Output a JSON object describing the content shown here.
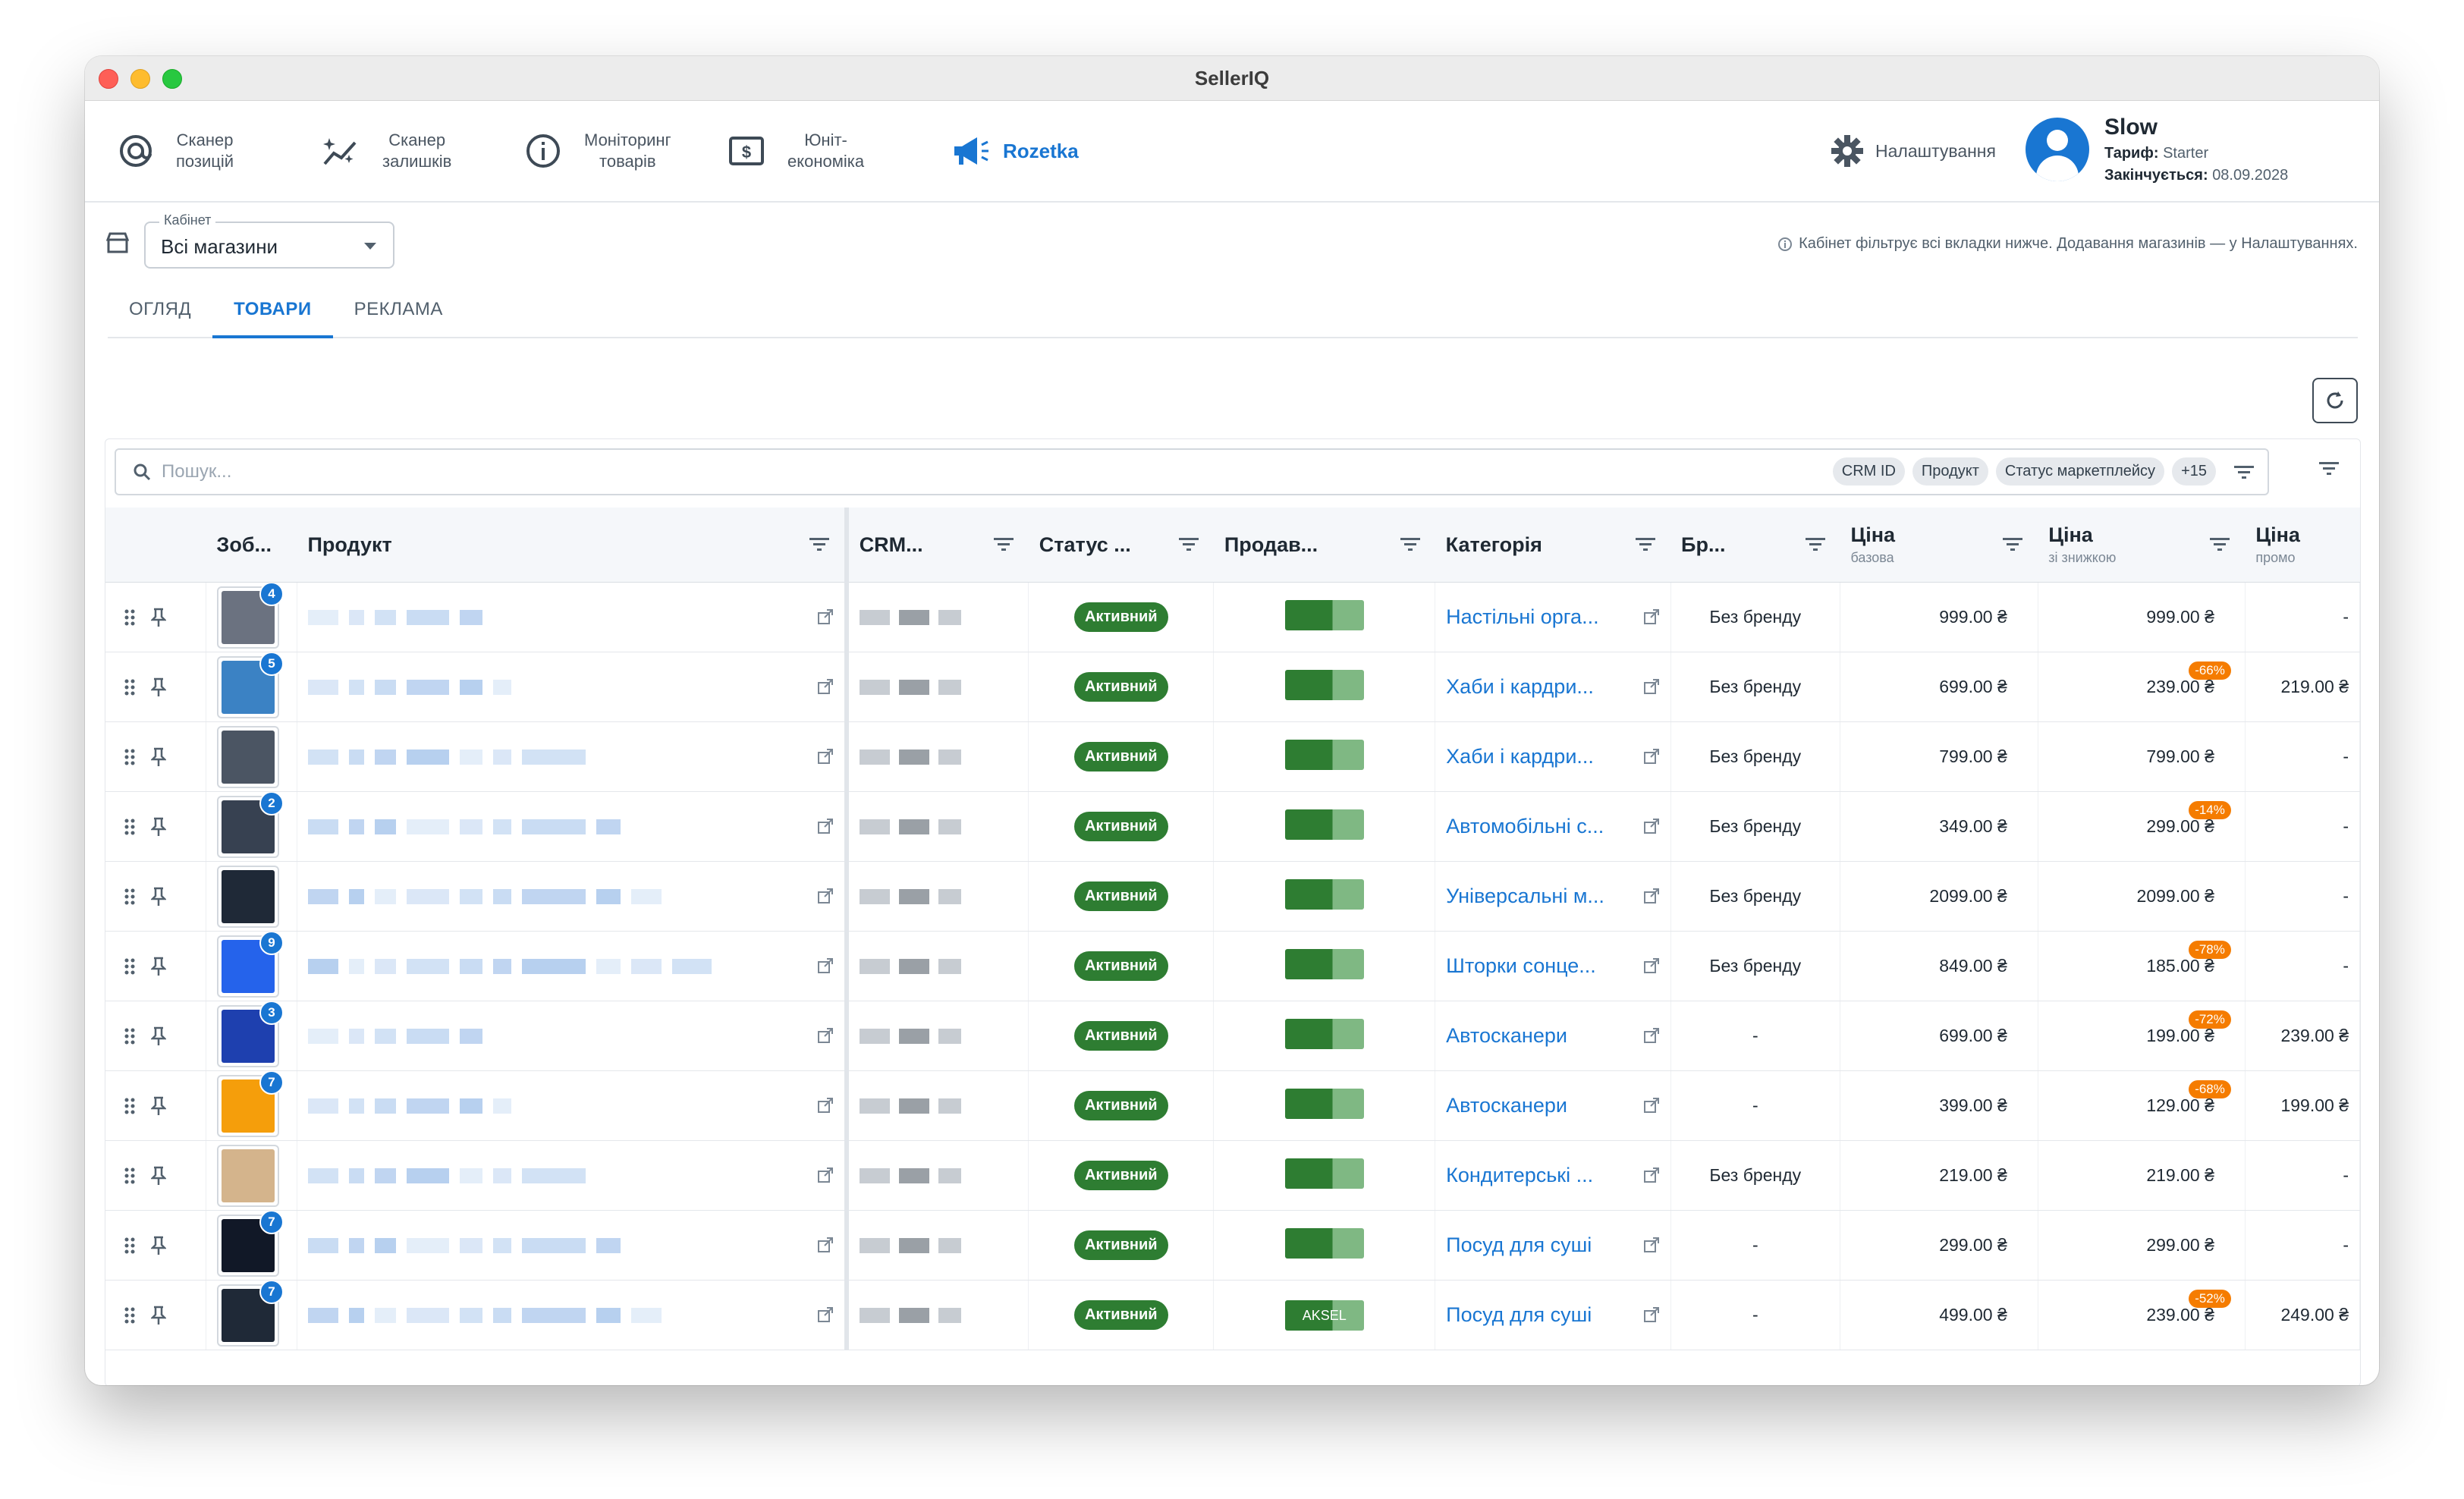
{
  "window": {
    "title": "SellerIQ"
  },
  "nav": {
    "items": [
      {
        "label": "Сканер\nпозицій",
        "icon": "at-target-icon"
      },
      {
        "label": "Сканер\nзалишків",
        "icon": "sparkle-chart-icon"
      },
      {
        "label": "Моніторинг\nтоварів",
        "icon": "info-circle-icon"
      },
      {
        "label": "Юніт-\nекономіка",
        "icon": "dollar-box-icon"
      },
      {
        "label": "Rozetka",
        "icon": "megaphone-icon",
        "active": true
      }
    ],
    "settings_label": "Налаштування"
  },
  "profile": {
    "name": "Slow",
    "tariff_label": "Тариф:",
    "tariff_value": "Starter",
    "expires_label": "Закінчується:",
    "expires_value": "08.09.2028"
  },
  "cabinet": {
    "legend": "Кабінет",
    "value": "Всі магазини",
    "hint": "Кабінет фільтрує всі вкладки нижче. Додавання магазинів — у Налаштуваннях."
  },
  "tabs": [
    {
      "label": "ОГЛЯД"
    },
    {
      "label": "ТОВАРИ",
      "active": true
    },
    {
      "label": "РЕКЛАМА"
    }
  ],
  "search": {
    "placeholder": "Пошук...",
    "chips": [
      "CRM ID",
      "Продукт",
      "Статус маркетплейсу",
      "+15"
    ]
  },
  "columns": {
    "image": "Зоб...",
    "product": "Продукт",
    "crm": "CRM...",
    "status": "Статус ...",
    "seller": "Продав...",
    "category": "Категорія",
    "brand": "Бр...",
    "price_base": "Ціна",
    "price_base_sub": "базова",
    "price_disc": "Ціна",
    "price_disc_sub": "зі знижкою",
    "price_promo": "Ціна",
    "price_promo_sub": "промо"
  },
  "rows": [
    {
      "badge": "4",
      "status": "Активний",
      "seller": "",
      "category": "Настільні орга...",
      "brand": "Без бренду",
      "base": "999.00 ₴",
      "disc": "999.00 ₴",
      "pct": "",
      "promo": "-",
      "thumb": "#6b7280"
    },
    {
      "badge": "5",
      "status": "Активний",
      "seller": "",
      "category": "Хаби і кардри...",
      "brand": "Без бренду",
      "base": "699.00 ₴",
      "disc": "239.00 ₴",
      "pct": "-66%",
      "promo": "219.00 ₴",
      "thumb": "#3b82c4"
    },
    {
      "badge": "",
      "status": "Активний",
      "seller": "",
      "category": "Хаби і кардри...",
      "brand": "Без бренду",
      "base": "799.00 ₴",
      "disc": "799.00 ₴",
      "pct": "",
      "promo": "-",
      "thumb": "#4b5563"
    },
    {
      "badge": "2",
      "status": "Активний",
      "seller": "",
      "category": "Автомобільні с...",
      "brand": "Без бренду",
      "base": "349.00 ₴",
      "disc": "299.00 ₴",
      "pct": "-14%",
      "promo": "-",
      "thumb": "#374151"
    },
    {
      "badge": "",
      "status": "Активний",
      "seller": "",
      "category": "Універсальні м...",
      "brand": "Без бренду",
      "base": "2099.00 ₴",
      "disc": "2099.00 ₴",
      "pct": "",
      "promo": "-",
      "thumb": "#1f2937"
    },
    {
      "badge": "9",
      "status": "Активний",
      "seller": "",
      "category": "Шторки сонце...",
      "brand": "Без бренду",
      "base": "849.00 ₴",
      "disc": "185.00 ₴",
      "pct": "-78%",
      "promo": "-",
      "thumb": "#2563eb"
    },
    {
      "badge": "3",
      "status": "Активний",
      "seller": "",
      "category": "Автосканери",
      "brand": "-",
      "base": "699.00 ₴",
      "disc": "199.00 ₴",
      "pct": "-72%",
      "promo": "239.00 ₴",
      "thumb": "#1e40af"
    },
    {
      "badge": "7",
      "status": "Активний",
      "seller": "",
      "category": "Автосканери",
      "brand": "-",
      "base": "399.00 ₴",
      "disc": "129.00 ₴",
      "pct": "-68%",
      "promo": "199.00 ₴",
      "thumb": "#f59e0b"
    },
    {
      "badge": "",
      "status": "Активний",
      "seller": "",
      "category": "Кондитерські ...",
      "brand": "Без бренду",
      "base": "219.00 ₴",
      "disc": "219.00 ₴",
      "pct": "",
      "promo": "-",
      "thumb": "#d4b48c"
    },
    {
      "badge": "7",
      "status": "Активний",
      "seller": "",
      "category": "Посуд для суші",
      "brand": "-",
      "base": "299.00 ₴",
      "disc": "299.00 ₴",
      "pct": "",
      "promo": "-",
      "thumb": "#111827"
    },
    {
      "badge": "7",
      "status": "Активний",
      "seller": "AKSEL",
      "category": "Посуд для суші",
      "brand": "-",
      "base": "499.00 ₴",
      "disc": "239.00 ₴",
      "pct": "-52%",
      "promo": "249.00 ₴",
      "thumb": "#1f2937"
    }
  ]
}
